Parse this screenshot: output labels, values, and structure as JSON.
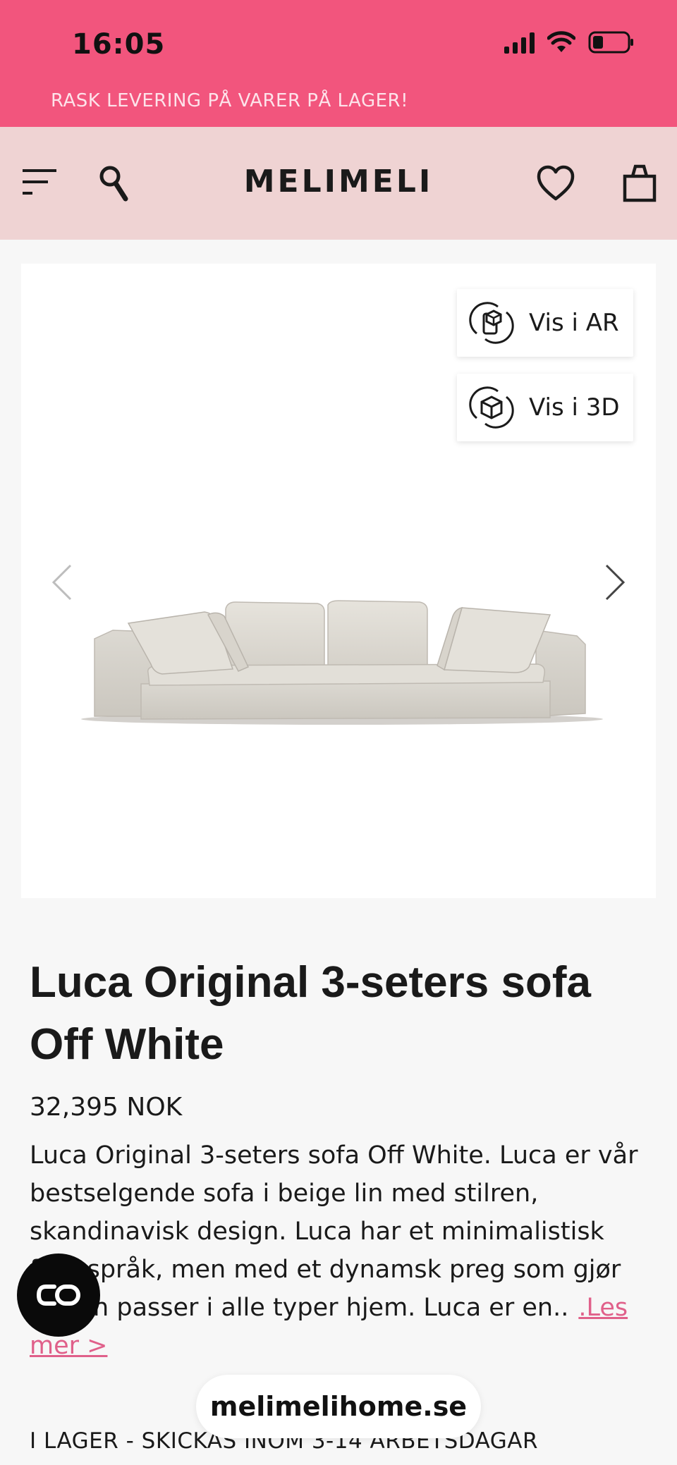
{
  "status_bar": {
    "time": "16:05"
  },
  "promo_banner": {
    "text": "RASK LEVERING PÅ VARER PÅ LAGER!"
  },
  "header": {
    "logo": "MELIMELI"
  },
  "gallery": {
    "ar_button": "Vis i AR",
    "three_d_button": "Vis i 3D"
  },
  "product": {
    "title": "Luca Original 3-seters sofa Off White",
    "price": "32,395 NOK",
    "description": "Luca Original 3-seters sofa Off White. Luca er vår bestselgende sofa i beige lin med stilren, skandinavisk design. Luca har et minimalistisk formspråk, men med et dynamsk preg som gjør at den passer i alle typer hjem. Luca er en..",
    "read_more": ".Les mer >",
    "stock_status": "I LAGER - SKICKAS INOM 3-14 ARBETSDAGAR"
  },
  "browser": {
    "url": "melimelihome.se"
  },
  "colors": {
    "brand_pink": "#f2557d",
    "header_bg": "#efd3d3",
    "link": "#e0608a"
  }
}
